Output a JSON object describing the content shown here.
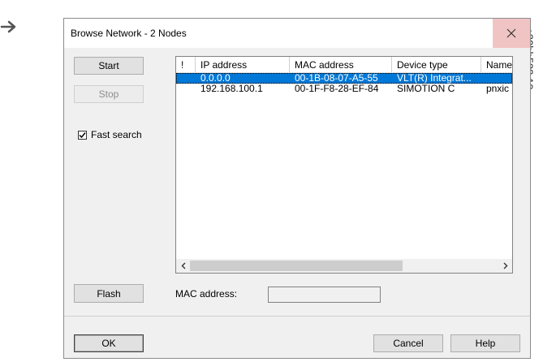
{
  "side_code": "e30bh523.10",
  "dialog": {
    "title": "Browse Network - 2 Nodes",
    "buttons": {
      "start": "Start",
      "stop": "Stop",
      "flash": "Flash",
      "ok": "OK",
      "cancel": "Cancel",
      "help": "Help"
    },
    "fast_search": {
      "label": "Fast search",
      "checked": true
    },
    "list": {
      "columns": [
        "!",
        "IP address",
        "MAC address",
        "Device type",
        "Name"
      ],
      "rows": [
        {
          "flag": "",
          "ip": "0.0.0.0",
          "mac": "00-1B-08-07-A5-55",
          "type": "VLT(R) Integrat...",
          "name": "",
          "selected": true
        },
        {
          "flag": "",
          "ip": "192.168.100.1",
          "mac": "00-1F-F8-28-EF-84",
          "type": "SIMOTION C",
          "name": "pnxic",
          "selected": false
        }
      ]
    },
    "mac_address": {
      "label": "MAC address:",
      "value": ""
    }
  }
}
